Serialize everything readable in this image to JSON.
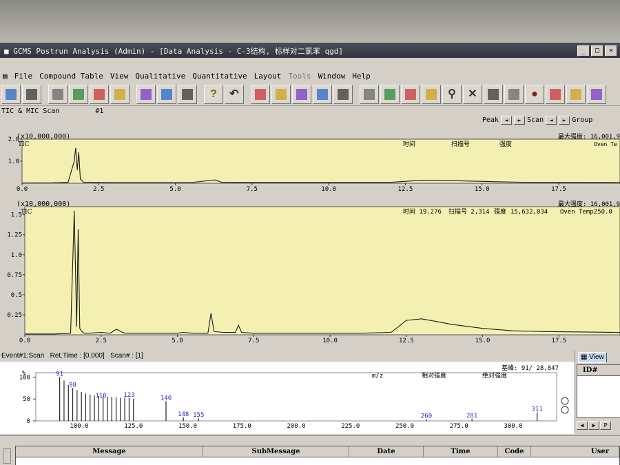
{
  "window": {
    "title": "GCMS Postrun Analysis (Admin) - [Data Analysis - C-3结构, 标样对二氯苯 qgd]",
    "controls": [
      "_",
      "□",
      "×"
    ]
  },
  "menu": [
    "File",
    "Compound Table",
    "View",
    "Qualitative",
    "Quantitative",
    "Layout",
    "Tools",
    "Window",
    "Help"
  ],
  "toolbar_icons": [
    "open-icon",
    "save-icon",
    "print-icon",
    "print-preview-icon",
    "peak-id-icon",
    "peak-id-2-icon",
    "layout-1-icon",
    "layout-2-icon",
    "layout-3-icon",
    "help-icon",
    "undo-icon",
    "table-edit-icon",
    "filter-icon",
    "spectrum-icon",
    "export-icon",
    "library-icon",
    "peak-a-icon",
    "peak-b-icon",
    "peak-c-icon",
    "chromatogram-icon",
    "search-icon",
    "tools-icon",
    "message-icon",
    "zoom-icon",
    "record-icon",
    "integrate-icon",
    "calibrate-icon",
    "bars-icon"
  ],
  "subbar": {
    "label": "TIC & MIC Scan",
    "index": "#1"
  },
  "nav": {
    "peak": "Peak",
    "scan": "Scan",
    "group": "Group"
  },
  "colors": {
    "plot_bg": "#f3f0b2",
    "panel_bg": "#ffffff",
    "trace": "#1a1a1a",
    "ion_label": "#2a2ad0",
    "window_bg": "#d4d0c8"
  },
  "chart_data": [
    {
      "type": "line",
      "id": "tic-overview",
      "multiplier": "(x10,000,000)",
      "series_label": "TIC",
      "header_labels": [
        "时间",
        "扫描号",
        "强度"
      ],
      "max_intensity": "最大强度: 16,001,9",
      "extra_label": "Oven Te",
      "xlim": [
        0,
        19.5
      ],
      "ylim": [
        0,
        2.0
      ],
      "xticks": [
        0.0,
        2.5,
        5.0,
        7.5,
        10.0,
        12.5,
        15.0,
        17.5
      ],
      "yticks": [
        1.0,
        2.0
      ],
      "x": [
        0,
        1.0,
        1.5,
        1.7,
        1.75,
        1.8,
        1.85,
        1.9,
        2.0,
        3.0,
        5.5,
        6.3,
        6.5,
        7.5,
        12.0,
        13.0,
        14.0,
        15.5,
        16.5,
        19.5
      ],
      "y": [
        0.01,
        0.02,
        0.04,
        1.0,
        1.6,
        0.6,
        1.4,
        0.2,
        0.05,
        0.03,
        0.03,
        0.15,
        0.05,
        0.04,
        0.04,
        0.13,
        0.12,
        0.07,
        0.04,
        0.03
      ]
    },
    {
      "type": "line",
      "id": "tic-main",
      "multiplier": "(x10,000,000)",
      "series_label": "TIC",
      "header_labels": [
        "时间 19.276",
        "扫描号 2,314",
        "强度",
        "15,632,034",
        "Oven Temp250.0"
      ],
      "max_intensity": "最大强度: 16,001,9",
      "xlim": [
        0,
        19.5
      ],
      "ylim": [
        0,
        1.6
      ],
      "xticks": [
        0.0,
        2.5,
        5.0,
        7.5,
        10.0,
        12.5,
        15.0,
        17.5
      ],
      "yticks": [
        0.25,
        0.5,
        0.75,
        1.0,
        1.25,
        1.5
      ],
      "x": [
        0,
        1.0,
        1.5,
        1.62,
        1.7,
        1.75,
        1.8,
        1.87,
        1.95,
        2.1,
        2.5,
        2.8,
        3.0,
        3.2,
        3.3,
        5.0,
        5.2,
        5.5,
        6.0,
        6.1,
        6.2,
        6.5,
        6.9,
        7.0,
        7.1,
        7.5,
        9.0,
        11.0,
        12.0,
        12.5,
        13.0,
        14.0,
        15.0,
        16.0,
        17.0,
        19.5
      ],
      "y": [
        0.01,
        0.01,
        0.02,
        1.55,
        0.1,
        1.32,
        0.08,
        0.04,
        0.02,
        0.02,
        0.03,
        0.02,
        0.07,
        0.03,
        0.02,
        0.02,
        0.03,
        0.02,
        0.02,
        0.27,
        0.04,
        0.03,
        0.03,
        0.12,
        0.03,
        0.02,
        0.02,
        0.02,
        0.03,
        0.18,
        0.2,
        0.13,
        0.08,
        0.05,
        0.04,
        0.03
      ]
    },
    {
      "type": "bar",
      "id": "mass-spectrum",
      "ylabel": "%",
      "header_labels": [
        "m/z",
        "相对强度",
        "绝对强度"
      ],
      "base_peak": "基峰: 91/ 28,847",
      "xlim": [
        80,
        320
      ],
      "ylim": [
        0,
        110
      ],
      "xticks": [
        100.0,
        125.0,
        150.0,
        175.0,
        200.0,
        225.0,
        250.0,
        275.0,
        300.0
      ],
      "yticks": [
        0,
        50,
        100
      ],
      "x": [
        91,
        93,
        95,
        97,
        99,
        101,
        103,
        105,
        107,
        109,
        111,
        113,
        115,
        117,
        119,
        121,
        123,
        125,
        140,
        148,
        155,
        260,
        281,
        311
      ],
      "y": [
        100,
        92,
        82,
        75,
        70,
        66,
        63,
        60,
        58,
        57,
        56,
        55,
        55,
        54,
        53,
        53,
        52,
        50,
        45,
        8,
        6,
        4,
        5,
        20
      ],
      "labels": [
        {
          "mz": 91,
          "text": "91"
        },
        {
          "mz": 97,
          "text": "98"
        },
        {
          "mz": 110,
          "text": "110"
        },
        {
          "mz": 123,
          "text": "123"
        },
        {
          "mz": 140,
          "text": "140"
        },
        {
          "mz": 148,
          "text": "148"
        },
        {
          "mz": 155,
          "text": "155"
        },
        {
          "mz": 260,
          "text": "260"
        },
        {
          "mz": 281,
          "text": "281"
        },
        {
          "mz": 311,
          "text": "311"
        }
      ]
    }
  ],
  "event_bar": {
    "event": "Event#1:Scan",
    "ret_time": "Ret.Time : [0.000]",
    "scan": "Scan# : [1]"
  },
  "view_panel": {
    "tab": "View",
    "column": "ID#"
  },
  "message_panel": {
    "columns": [
      "Message",
      "SubMessage",
      "Date",
      "Time",
      "Code",
      "User"
    ]
  }
}
